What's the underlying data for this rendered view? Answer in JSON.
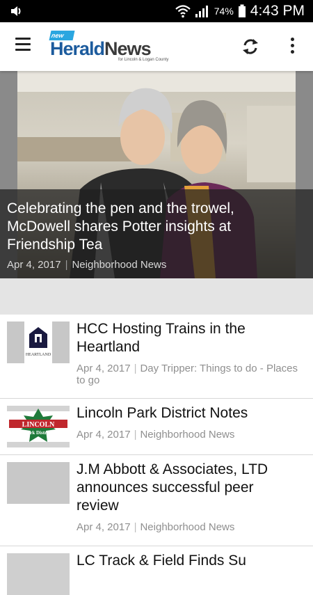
{
  "status_bar": {
    "battery_percent": "74%",
    "time": "4:43 PM"
  },
  "app_bar": {
    "logo_badge": "new",
    "logo_word1": "Herald",
    "logo_word2": "News",
    "logo_tagline": "for Lincoln & Logan County"
  },
  "hero": {
    "title": "Celebrating the pen and the trowel, McDowell shares Potter insights at Friendship Tea",
    "date": "Apr 4, 2017",
    "category": "Neighborhood News"
  },
  "articles": [
    {
      "title": "HCC Hosting Trains in the Heartland",
      "date": "Apr 4, 2017",
      "category": "Day Tripper: Things to do - Places to go",
      "thumb_text": "HEARTLAND"
    },
    {
      "title": "Lincoln Park District Notes",
      "date": "Apr 4, 2017",
      "category": "Neighborhood News",
      "thumb_text_1": "LINCOLN",
      "thumb_text_2": "Park District"
    },
    {
      "title": "J.M Abbott & Associates, LTD announces successful peer review",
      "date": "Apr 4, 2017",
      "category": "Neighborhood News"
    },
    {
      "title": "LC Track & Field Finds Su"
    }
  ],
  "colors": {
    "brand_blue": "#1c5b9d",
    "badge_blue": "#2aa6e0",
    "lincoln_red": "#c0272d",
    "lincoln_green": "#1f7a3a"
  }
}
